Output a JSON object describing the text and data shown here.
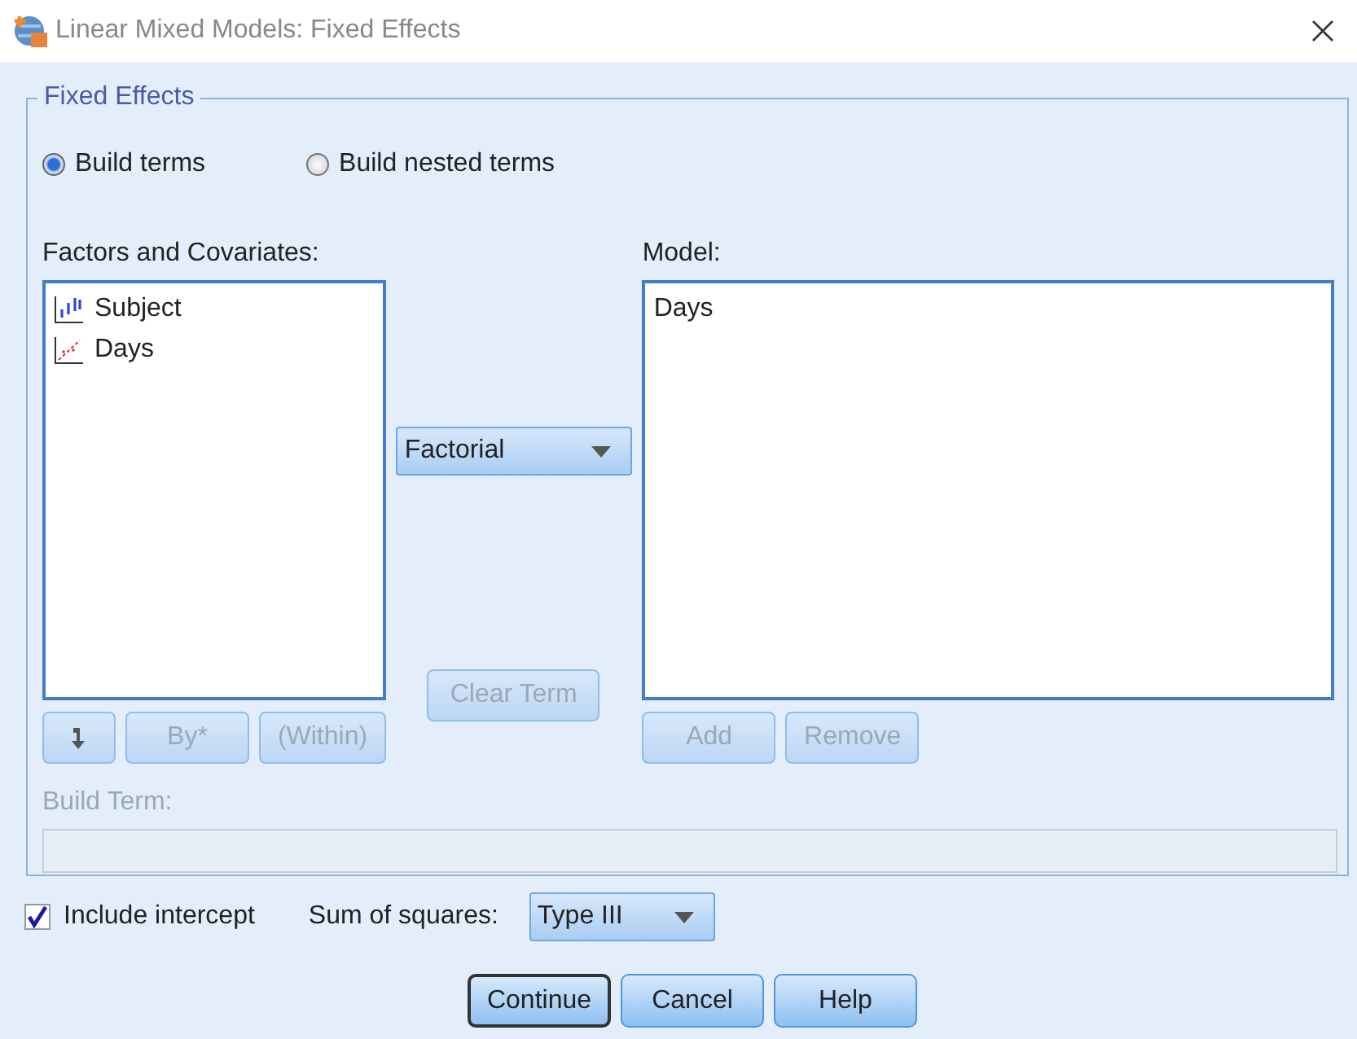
{
  "window": {
    "title": "Linear Mixed Models: Fixed Effects"
  },
  "fixed_effects": {
    "title": "Fixed Effects",
    "modes": [
      {
        "label": "Build terms",
        "selected": true
      },
      {
        "label": "Build nested terms",
        "selected": false
      }
    ],
    "factors_list": {
      "label": "Factors and Covariates:",
      "items": [
        {
          "label": "Subject",
          "kind": "nominal"
        },
        {
          "label": "Days",
          "kind": "scale"
        }
      ]
    },
    "term_type": {
      "value": "Factorial"
    },
    "model_list": {
      "label": "Model:",
      "items": [
        "Days"
      ]
    },
    "left_buttons": [
      {
        "kind": "arrow",
        "disabled": false
      },
      {
        "kind": "text",
        "label": "By*",
        "disabled": true
      },
      {
        "kind": "text",
        "label": "(Within)",
        "disabled": true
      }
    ],
    "middle_button": {
      "label": "Clear Term",
      "disabled": true
    },
    "right_buttons": [
      {
        "label": "Add",
        "disabled": true
      },
      {
        "label": "Remove",
        "disabled": true
      }
    ],
    "build_term": {
      "label": "Build Term:",
      "disabled": true
    }
  },
  "include_intercept": {
    "label": "Include intercept",
    "checked": true
  },
  "sum_of_squares": {
    "label": "Sum of squares:",
    "value": "Type III"
  },
  "buttons": [
    {
      "label": "Continue",
      "default": true
    },
    {
      "label": "Cancel",
      "default": false
    },
    {
      "label": "Help",
      "default": false
    }
  ]
}
